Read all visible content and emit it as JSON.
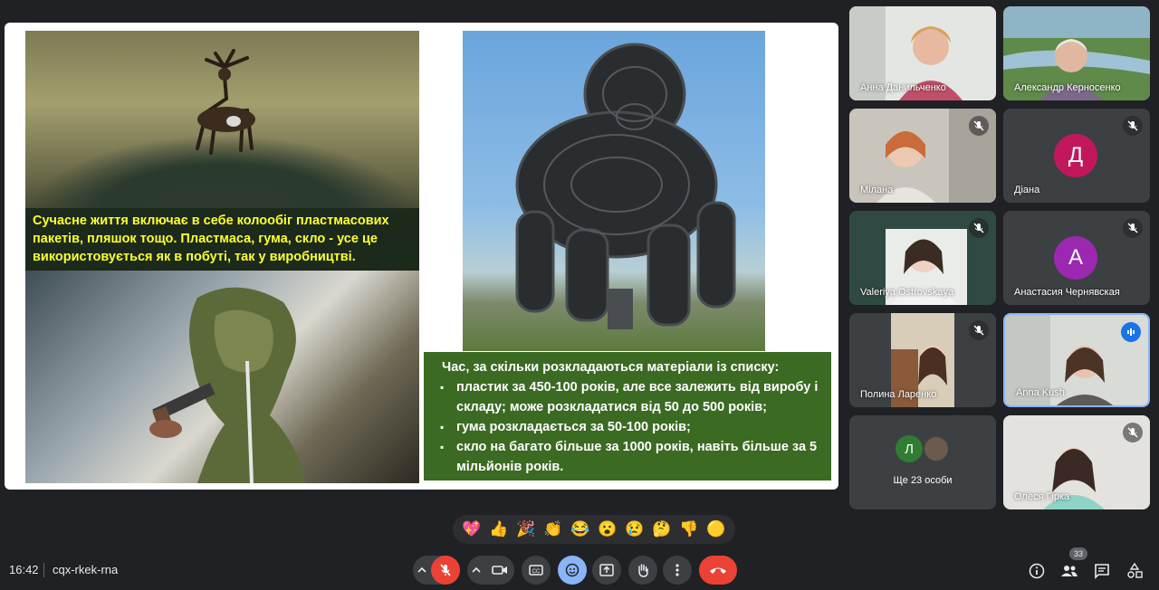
{
  "slide": {
    "caption_top": "Сучасне життя включає в себе колообіг пластмасових пакетів, пляшок тощо. Пластмаса, гума, скло - усе це використовується як в побуті, так у виробництві.",
    "box_lead": "Час, за скільки розкладаються матеріали із списку:",
    "box_items": [
      "пластик за 450-100 років, але все залежить від виробу і складу; може розкладатися від 50 до 500 років;",
      "гума розкладається за 50-100 років;",
      "скло на багато більше за 1000 років, навіть більше за 5 мільйонів років."
    ]
  },
  "participants": [
    {
      "name": "Анна Данильченко",
      "muted": false
    },
    {
      "name": "Александр Керносенко",
      "muted": false
    },
    {
      "name": "Мілана",
      "muted": true
    },
    {
      "name": "Діана",
      "muted": true,
      "initial": "Д",
      "color": "#c2185b"
    },
    {
      "name": "Valeriya Ostrovskaya",
      "muted": true
    },
    {
      "name": "Анастасия Чернявская",
      "muted": true,
      "initial": "А",
      "color": "#9c27b0"
    },
    {
      "name": "Полина Ларенко",
      "muted": true
    },
    {
      "name": "Anna Kush",
      "muted": false,
      "speaking": true
    },
    {
      "name": "Ще 23 особи",
      "initial": "Л",
      "color": "#2e7d32"
    },
    {
      "name": "Олеся Гірка",
      "muted": true
    }
  ],
  "reactions": [
    "💖",
    "👍",
    "🎉",
    "👏",
    "😂",
    "😮",
    "😢",
    "🤔",
    "👎",
    "🟡"
  ],
  "footer": {
    "time": "16:42",
    "meeting_code": "cqx-rkek-rna",
    "participant_count": "33"
  },
  "colors": {
    "end_call": "#ea4335",
    "mic_off": "#ea4335",
    "active_button": "#8ab4f8",
    "speaking_border": "#8ab4f8"
  }
}
